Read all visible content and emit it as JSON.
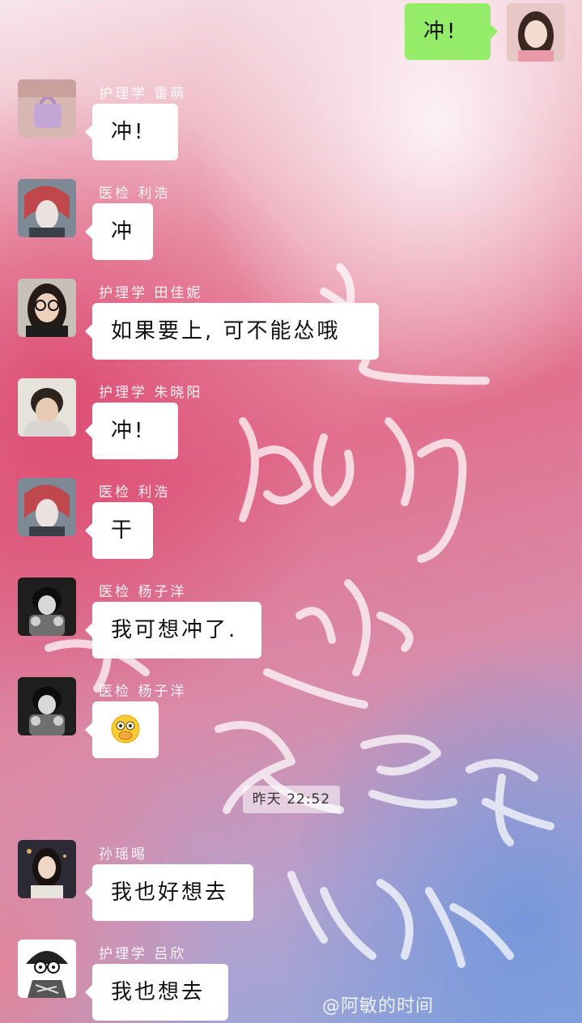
{
  "messages": [
    {
      "sender": "",
      "text": "冲!",
      "mine": true
    },
    {
      "sender": "护理学 雷萌",
      "text": "冲!"
    },
    {
      "sender": "医检 利浩",
      "text": "冲"
    },
    {
      "sender": "护理学 田佳妮",
      "text": "如果要上, 可不能怂哦"
    },
    {
      "sender": "护理学 朱晓阳",
      "text": "冲!"
    },
    {
      "sender": "医检 利浩",
      "text": "干"
    },
    {
      "sender": "医检 杨子洋",
      "text": "我可想冲了."
    },
    {
      "sender": "医检 杨子洋",
      "text": "",
      "emoji": "hand-over-mouth-emoji"
    },
    {
      "sender": "孙瑶晹",
      "text": "我也好想去"
    },
    {
      "sender": "护理学 吕欣",
      "text": "我也想去"
    }
  ],
  "timestamp": "昨天 22:52",
  "watermark": "@阿敏的时间",
  "colors": {
    "my_bubble": "#95ec69",
    "their_bubble": "#ffffff",
    "sender_name": "#ffffff"
  }
}
